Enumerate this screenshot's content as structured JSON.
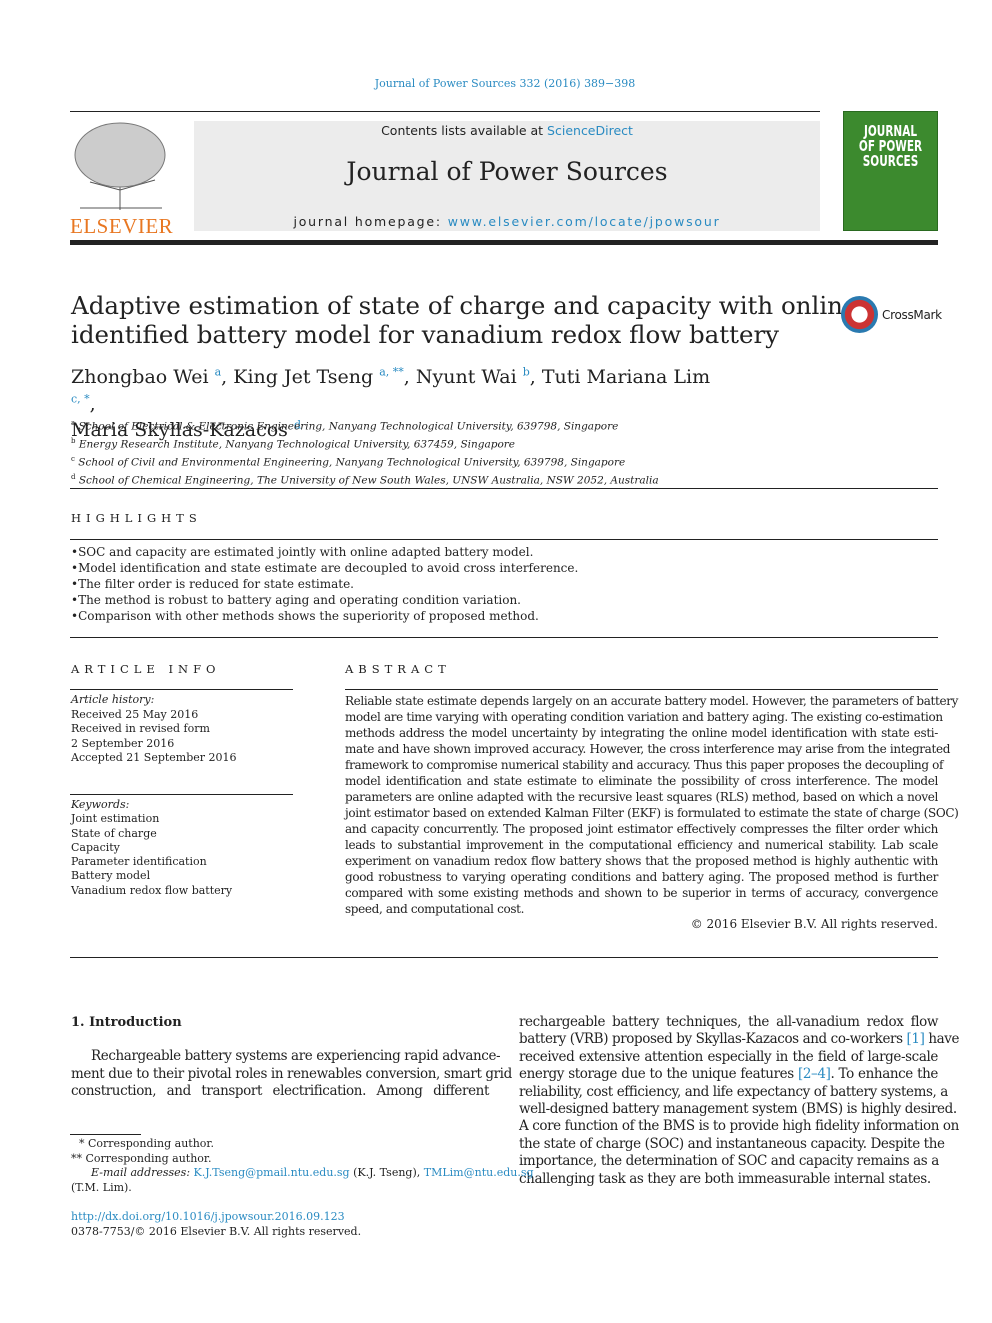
{
  "citation": "Journal of Power Sources 332 (2016) 389−398",
  "masthead": {
    "contents_prefix": "Contents lists available at ",
    "contents_link": "ScienceDirect",
    "journal": "Journal of Power Sources",
    "homepage_prefix": "journal homepage: ",
    "homepage_link": "www.elsevier.com/locate/jpowsour",
    "publisher": "ELSEVIER",
    "cover_title": "JOURNAL OF POWER SOURCES"
  },
  "title_lines": [
    "Adaptive estimation of state of charge and capacity with online",
    "identified battery model for vanadium redox flow battery"
  ],
  "crossmark": "CrossMark",
  "authors": [
    {
      "name": "Zhongbao Wei",
      "sup": "a",
      "sep": ", "
    },
    {
      "name": "King Jet Tseng",
      "sup": "a, **",
      "sep": ", "
    },
    {
      "name": "Nyunt Wai",
      "sup": "b",
      "sep": ", "
    },
    {
      "name": "Tuti Mariana Lim",
      "sup": "c, *",
      "sep": ","
    },
    {
      "name": "Maria Skyllas-Kazacos",
      "sup": "d",
      "sep": ""
    }
  ],
  "affiliations": [
    {
      "key": "a",
      "text": "School of Electrical & Electronic Engineering, Nanyang Technological University, 639798, Singapore"
    },
    {
      "key": "b",
      "text": "Energy Research Institute, Nanyang Technological University, 637459, Singapore"
    },
    {
      "key": "c",
      "text": "School of Civil and Environmental Engineering, Nanyang Technological University, 639798, Singapore"
    },
    {
      "key": "d",
      "text": "School of Chemical Engineering, The University of New South Wales, UNSW Australia, NSW 2052, Australia"
    }
  ],
  "highlights": {
    "heading": "HIGHLIGHTS",
    "items": [
      "SOC and capacity are estimated jointly with online adapted battery model.",
      "Model identification and state estimate are decoupled to avoid cross interference.",
      "The filter order is reduced for state estimate.",
      "The method is robust to battery aging and operating condition variation.",
      "Comparison with other methods shows the superiority of proposed method."
    ]
  },
  "article_info": {
    "heading": "ARTICLE INFO",
    "history_label": "Article history:",
    "history": [
      "Received 25 May 2016",
      "Received in revised form",
      "2 September 2016",
      "Accepted 21 September 2016"
    ],
    "keywords_label": "Keywords:",
    "keywords": [
      "Joint estimation",
      "State of charge",
      "Capacity",
      "Parameter identification",
      "Battery model",
      "Vanadium redox flow battery"
    ]
  },
  "abstract": {
    "heading": "ABSTRACT",
    "lines": [
      "Reliable state estimate depends largely on an accurate battery model. However, the parameters of battery",
      "model are time varying with operating condition variation and battery aging. The existing co-estimation",
      "methods address the model uncertainty by integrating the online model identification with state esti-",
      "mate and have shown improved accuracy. However, the cross interference may arise from the integrated",
      "framework to compromise numerical stability and accuracy. Thus this paper proposes the decoupling of",
      "model identification and state estimate to eliminate the possibility of cross interference. The model",
      "parameters are online adapted with the recursive least squares (RLS) method, based on which a novel",
      "joint estimator based on extended Kalman Filter (EKF) is formulated to estimate the state of charge (SOC)",
      "and capacity concurrently. The proposed joint estimator effectively compresses the filter order which",
      "leads to substantial improvement in the computational efficiency and numerical stability. Lab scale",
      "experiment on vanadium redox flow battery shows that the proposed method is highly authentic with",
      "good robustness to varying operating conditions and battery aging. The proposed method is further",
      "compared with some existing methods and shown to be superior in terms of accuracy, convergence",
      "speed, and computational cost."
    ],
    "copyright": "© 2016 Elsevier B.V. All rights reserved."
  },
  "intro": {
    "heading": "1.  Introduction",
    "left_lines": [
      "Rechargeable battery systems are experiencing rapid advance-",
      "ment due to their pivotal roles in renewables conversion, smart grid",
      "construction, and transport electrification. Among different"
    ],
    "right_lines": [
      {
        "a": "rechargeable battery techniques, the all-vanadium redox flow",
        "ref": "",
        "b": ""
      },
      {
        "a": "battery (VRB) proposed by Skyllas-Kazacos and co-workers ",
        "ref": "[1]",
        "b": " have"
      },
      {
        "a": "received extensive attention especially in the field of large-scale",
        "ref": "",
        "b": ""
      },
      {
        "a": "energy storage due to the unique features ",
        "ref": "[2–4]",
        "b": ". To enhance the"
      },
      {
        "a": "reliability, cost efficiency, and life expectancy of battery systems, a",
        "ref": "",
        "b": ""
      },
      {
        "a": "well-designed battery management system (BMS) is highly desired.",
        "ref": "",
        "b": ""
      },
      {
        "a": "A core function of the BMS is to provide high fidelity information on",
        "ref": "",
        "b": ""
      },
      {
        "a": "the state of charge (SOC) and instantaneous capacity. Despite the",
        "ref": "",
        "b": ""
      },
      {
        "a": "importance, the determination of SOC and capacity remains as a",
        "ref": "",
        "b": ""
      },
      {
        "a": "challenging task as they are both immeasurable internal states.",
        "ref": "",
        "b": ""
      }
    ]
  },
  "footnotes": {
    "star1": "*",
    "star1_text": "Corresponding author.",
    "star2": "**",
    "star2_text": "Corresponding author.",
    "email_label": "E-mail addresses: ",
    "email1": "K.J.Tseng@pmail.ntu.edu.sg",
    "email1_who": " (K.J. Tseng), ",
    "email2": "TMLim@ntu.edu.sg",
    "email2_who": "(T.M. Lim).",
    "doi": "http://dx.doi.org/10.1016/j.jpowsour.2016.09.123",
    "issn": "0378-7753/© 2016 Elsevier B.V. All rights reserved."
  }
}
